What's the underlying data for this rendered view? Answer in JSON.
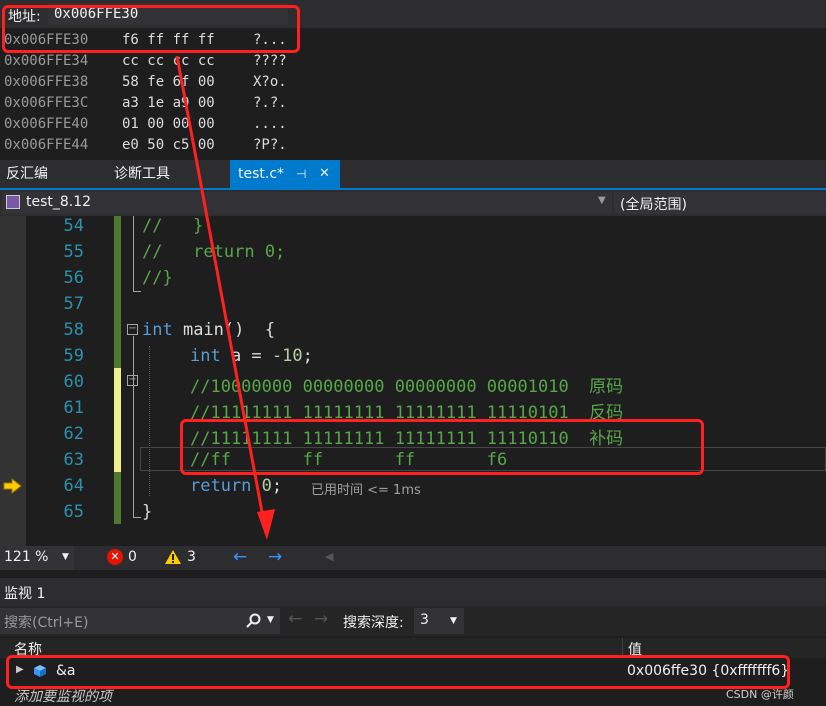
{
  "memory": {
    "address_label": "地址:",
    "address_value": "0x006FFE30",
    "rows": [
      {
        "addr": "0x006FFE30",
        "bytes": "f6 ff ff ff",
        "chars": "?..."
      },
      {
        "addr": "0x006FFE34",
        "bytes": "cc cc cc cc",
        "chars": "????"
      },
      {
        "addr": "0x006FFE38",
        "bytes": "58 fe 6f 00",
        "chars": "X?o."
      },
      {
        "addr": "0x006FFE3C",
        "bytes": "a3 1e a9 00",
        "chars": "?.?."
      },
      {
        "addr": "0x006FFE40",
        "bytes": "01 00 00 00",
        "chars": "...."
      },
      {
        "addr": "0x006FFE44",
        "bytes": "e0 50 c5 00",
        "chars": "?P?."
      }
    ]
  },
  "tabs": {
    "disasm": "反汇编",
    "diag": "诊断工具",
    "active_file": "test.c*",
    "pin": "⊣",
    "close": "✕"
  },
  "navbar": {
    "project": "test_8.12",
    "scope": "(全局范围)"
  },
  "editor": {
    "lines": [
      {
        "n": "54",
        "code": "//   }"
      },
      {
        "n": "55",
        "code": "//   return 0;"
      },
      {
        "n": "56",
        "code": "//}"
      },
      {
        "n": "57",
        "code": ""
      },
      {
        "n": "58",
        "kw": "int",
        "rest": " main()  {"
      },
      {
        "n": "59",
        "kw": "int",
        "rest": " a = ",
        "num": "-10",
        "end": ";"
      },
      {
        "n": "60",
        "code": "//10000000 00000000 00000000 00001010  原码"
      },
      {
        "n": "61",
        "code": "//11111111 11111111 11111111 11110101  反码"
      },
      {
        "n": "62",
        "code": "//11111111 11111111 11111111 11110110  补码"
      },
      {
        "n": "63",
        "code": "//ff       ff       ff       f6"
      },
      {
        "n": "64",
        "kw": "return",
        "rest": " ",
        "num": "0",
        "end": ";",
        "hint": "已用时间 <= 1ms"
      },
      {
        "n": "65",
        "code": "}"
      }
    ]
  },
  "status": {
    "zoom": "121 %",
    "errors": "0",
    "warnings": "3"
  },
  "watch": {
    "title": "监视 1",
    "search_placeholder": "搜索(Ctrl+E)",
    "depth_label": "搜索深度:",
    "depth_value": "3",
    "col_name": "名称",
    "col_value": "值",
    "row_name": "&a",
    "row_value": "0x006ffe30 {0xfffffff6}",
    "add_hint": "添加要监视的项",
    "watermark": "CSDN @许颜"
  },
  "colors": {
    "accent": "#007acc",
    "highlight": "#ff2020",
    "comment": "#57a64a",
    "keyword": "#569cd6",
    "line_number": "#2b91af"
  }
}
